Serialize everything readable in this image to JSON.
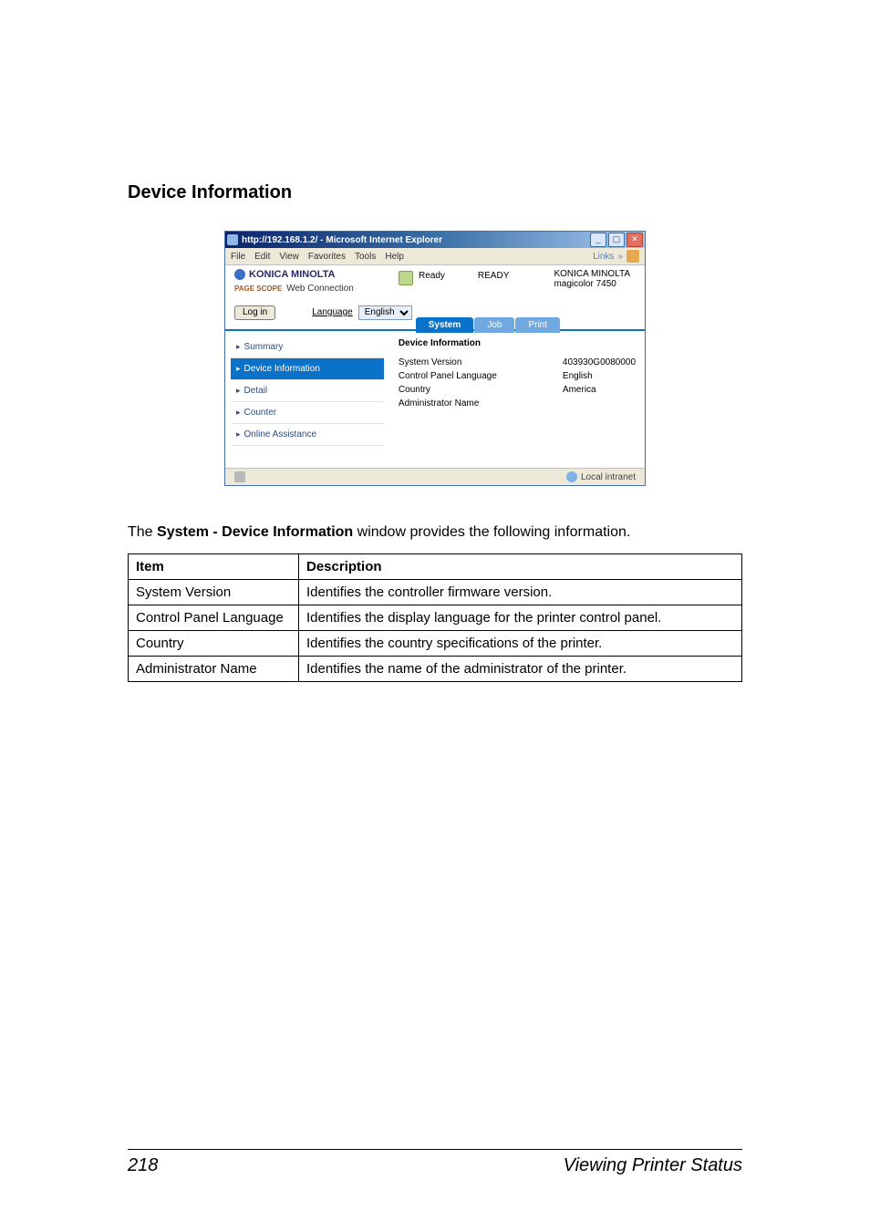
{
  "heading": "Device Information",
  "ie_window": {
    "title": "http://192.168.1.2/ - Microsoft Internet Explorer",
    "menus": [
      "File",
      "Edit",
      "View",
      "Favorites",
      "Tools",
      "Help"
    ],
    "links_label": "Links",
    "brand": "KONICA MINOLTA",
    "pagescope": "Web Connection",
    "pagescope_prefix": "PAGE SCOPE",
    "status_label": "Ready",
    "status_big": "READY",
    "model_brand": "KONICA MINOLTA",
    "model_name": "magicolor 7450",
    "login_button": "Log in",
    "language_label": "Language",
    "language_value": "English",
    "tabs": {
      "system": "System",
      "job": "Job",
      "print": "Print"
    },
    "nav": {
      "summary": "Summary",
      "device_info": "Device Information",
      "detail": "Detail",
      "counter": "Counter",
      "online_assist": "Online Assistance"
    },
    "section_title": "Device Information",
    "rows": {
      "sys_ver_k": "System Version",
      "sys_ver_v": "403930G0080000",
      "cpl_k": "Control Panel Language",
      "cpl_v": "English",
      "country_k": "Country",
      "country_v": "America",
      "admin_k": "Administrator Name",
      "admin_v": ""
    },
    "zone": "Local intranet"
  },
  "desc_para_prefix": "The ",
  "desc_para_bold": "System - Device Information",
  "desc_para_suffix": " window provides the following information.",
  "table": {
    "head_item": "Item",
    "head_desc": "Description",
    "r1_item": "System Version",
    "r1_desc": "Identifies the controller firmware version.",
    "r2_item": "Control Panel Language",
    "r2_desc": "Identifies the display language for the printer control panel.",
    "r3_item": "Country",
    "r3_desc": "Identifies the country specifications of the printer.",
    "r4_item": "Administrator Name",
    "r4_desc": "Identifies the name of the administrator of the printer."
  },
  "footer": {
    "page_no": "218",
    "section": "Viewing Printer Status"
  }
}
